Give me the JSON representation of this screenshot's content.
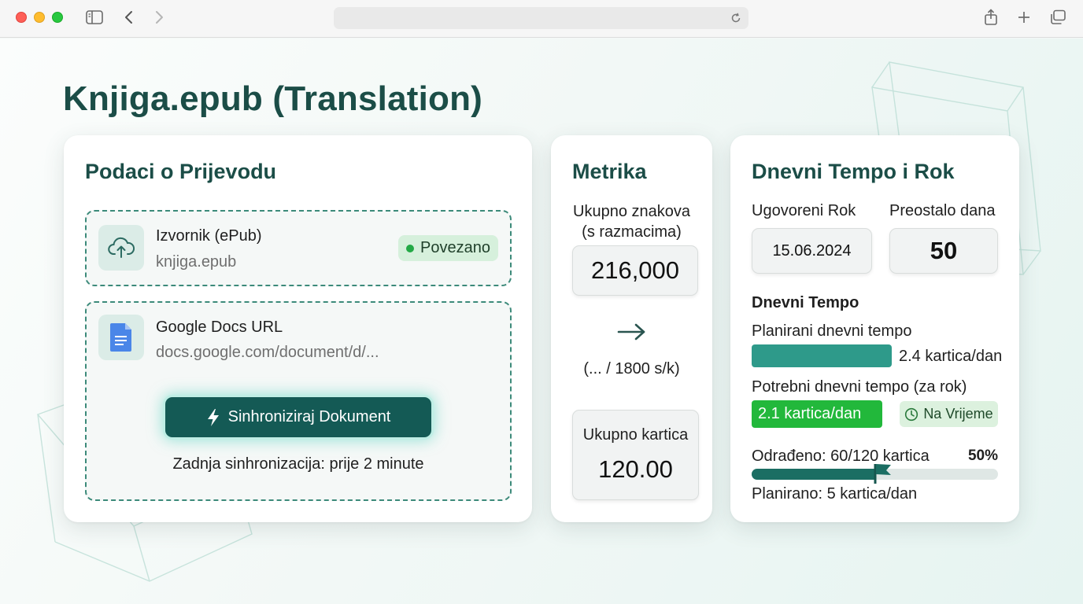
{
  "browser": {
    "address": ""
  },
  "page": {
    "title": "Knjiga.epub (Translation)"
  },
  "translation_card": {
    "title": "Podaci o Prijevodu",
    "source": {
      "title": "Izvornik (ePub)",
      "file": "knjiga.epub",
      "status": "Povezano",
      "icon": "cloud-upload-icon"
    },
    "gdocs": {
      "title": "Google Docs URL",
      "url": "docs.google.com/document/d/...",
      "icon": "google-docs-icon",
      "sync_button": "Sinhroniziraj Dokument",
      "last_sync": "Zadnja sinhronizacija: prije 2 minute"
    }
  },
  "metrics_card": {
    "title": "Metrika",
    "chars_label_line1": "Ukupno znakova",
    "chars_label_line2": "(s razmacima)",
    "chars_total": "216,000",
    "ratio": "(... / 1800 s/k)",
    "cards_label": "Ukupno kartica",
    "cards_total": "120.00"
  },
  "pace_card": {
    "title": "Dnevni Tempo i Rok",
    "deadline_label": "Ugovoreni Rok",
    "deadline_value": "15.06.2024",
    "days_left_label": "Preostalo dana",
    "days_left_value": "50",
    "section_label": "Dnevni Tempo",
    "planned_label": "Planirani dnevni tempo",
    "planned_value": "2.4 kartica/dan",
    "needed_label": "Potrebni dnevni tempo (za rok)",
    "needed_value": "2.1 kartica/dan",
    "status": "Na Vrijeme",
    "done_label": "Odrađeno: 60/120 kartica",
    "done_percent": "50%",
    "progress_fraction": 0.5,
    "planned_total": "Planirano: 5 kartica/dan"
  },
  "colors": {
    "accent": "#1b4d47",
    "button": "#145a55",
    "success": "#22b83b",
    "teal_bar": "#2e9a8a"
  }
}
